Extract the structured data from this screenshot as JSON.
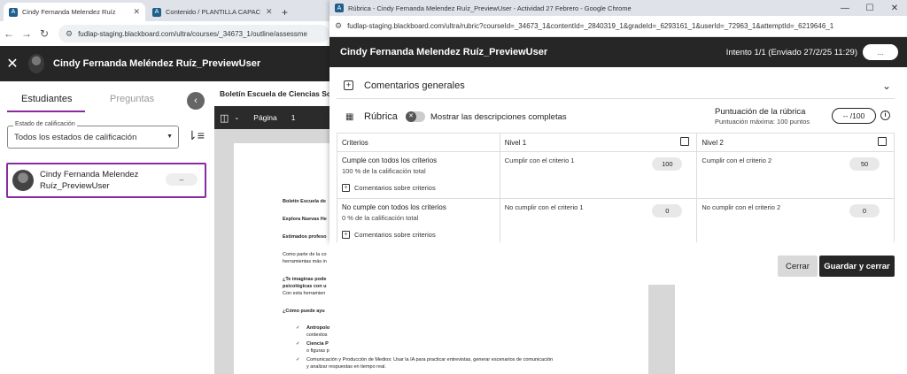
{
  "back_browser": {
    "tabs": [
      {
        "label": "Cindy Fernanda Melendez Ruíz",
        "fav": "A"
      },
      {
        "label": "Contenido / PLANTILLA CAPAC",
        "fav": "A"
      }
    ],
    "new_tab": "+",
    "url": "fudlap-staging.blackboard.com/ultra/courses/_34673_1/outline/assessme"
  },
  "grader": {
    "header_name": "Cindy Fernanda Meléndez Ruíz_PreviewUser",
    "tab_students": "Estudiantes",
    "tab_questions": "Preguntas",
    "filter_label": "Estado de calificación",
    "filter_value": "Todos los estados de calificación",
    "student_name_1": "Cindy Fernanda Melendez",
    "student_name_2": "Ruíz_PreviewUser",
    "student_grade": "--"
  },
  "document": {
    "title": "Boletín Escuela de Ciencias Soc",
    "page_label": "Página",
    "page_num": "1",
    "lines": [
      "Boletín Escuela de",
      "Explora Nuevas He",
      "Estimados profeso",
      "Como parte de la co",
      "herramientas más in",
      "¿Te imaginas pode",
      "psicológicas con u",
      "Con esta herramien",
      "¿Cómo puede ayu",
      "Antropolo",
      "contextos",
      "Ciencia P",
      "o figuras p"
    ],
    "lines_wide": [
      "Comunicación y Producción de Medios: Usar la IA para practicar entrevistas, generar escenarios de comunicación",
      "y analizar respuestas en tiempo real."
    ]
  },
  "popup": {
    "window_title": "Rúbrica - Cindy Fernanda Melendez Ruíz_PreviewUser - Actividad 27 Febrero - Google Chrome",
    "url": "fudlap-staging.blackboard.com/ultra/rubric?courseId=_34673_1&contentId=_2840319_1&gradeId=_6293161_1&userId=_72963_1&attemptId=_6219646_1",
    "header_name": "Cindy Fernanda Melendez Ruíz_PreviewUser",
    "attempt": "Intento 1/1 (Enviado 27/2/25 11:29)",
    "more": "...",
    "general_comments": "Comentarios generales",
    "rubric_title": "Rúbrica",
    "toggle_label": "Mostrar las descripciones completas",
    "score_label": "Puntuación de la rúbrica",
    "score_max": "Puntuación máxima: 100 puntos",
    "score_value": "-- /100",
    "col_criteria": "Criterios",
    "col_level1": "Nivel 1",
    "col_level2": "Nivel 2",
    "rows": [
      {
        "title": "Cumple con todos los criterios",
        "sub": "100 % de la calificación total",
        "comment": "Comentarios sobre criterios",
        "l1": "Cumplir con el criterio 1",
        "l1_pts": "100",
        "l2": "Cumplir con el criterio 2",
        "l2_pts": "50"
      },
      {
        "title": "No cumple con todos los criterios",
        "sub": "0 % de la calificación total",
        "comment": "Comentarios sobre criterios",
        "l1": "No cumplir con el criterio 1",
        "l1_pts": "0",
        "l2": "No cumplir con el criterio 2",
        "l2_pts": "0"
      }
    ],
    "cancel": "Cerrar",
    "save": "Guardar y cerrar"
  }
}
